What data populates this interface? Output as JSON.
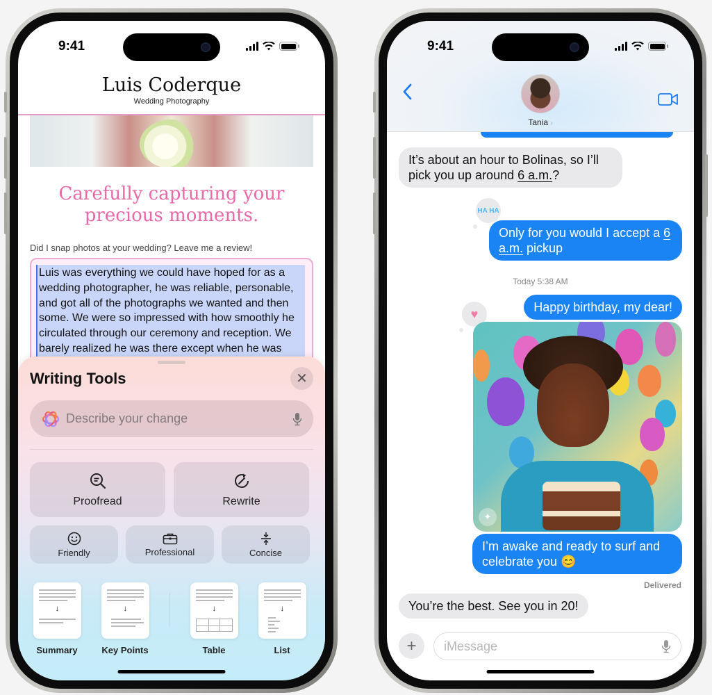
{
  "left_phone": {
    "status": {
      "time": "9:41"
    },
    "site": {
      "title": "Luis Coderque",
      "subtitle": "Wedding Photography",
      "tagline_line1": "Carefully capturing your",
      "tagline_line2": "precious moments.",
      "review_prompt": "Did I snap photos at your wedding? Leave me a review!",
      "review_text": "Luis was everything we could have hoped for as a wedding photographer, he was reliable, personable, and got all of the photographs we wanted and then some. We were so impressed with how smoothly he circulated through our ceremony and reception. We barely realized he was there except when he was very"
    },
    "writing_tools": {
      "title": "Writing Tools",
      "close_icon": "close-icon",
      "input_placeholder": "Describe your change",
      "primary_tools": [
        {
          "label": "Proofread",
          "icon": "proofread-magnifier-icon"
        },
        {
          "label": "Rewrite",
          "icon": "rewrite-icon"
        }
      ],
      "tone_tools": [
        {
          "label": "Friendly",
          "icon": "smiley-icon"
        },
        {
          "label": "Professional",
          "icon": "briefcase-icon"
        },
        {
          "label": "Concise",
          "icon": "compress-icon"
        }
      ],
      "format_tools": [
        {
          "label": "Summary"
        },
        {
          "label": "Key Points"
        },
        {
          "label": "Table"
        },
        {
          "label": "List"
        }
      ]
    }
  },
  "right_phone": {
    "status": {
      "time": "9:41"
    },
    "contact": {
      "name": "Tania",
      "chevron": "›"
    },
    "messages": [
      {
        "dir": "in",
        "text_pre": "It’s about an hour to Bolinas, so I’ll pick you up around ",
        "link": "6 a.m.",
        "text_post": "?"
      },
      {
        "dir": "out",
        "text_pre": "Only for you would I accept a ",
        "link": "6 a.m.",
        "text_post": " pickup",
        "reaction": "HA HA"
      },
      {
        "dir": "out",
        "text": "Happy birthday, my dear!",
        "reaction": "♥"
      },
      {
        "dir": "out",
        "type": "image",
        "alt": "Genmoji birthday portrait with balloons and cake"
      },
      {
        "dir": "out",
        "text": "I’m awake and ready to surf and celebrate you 😊"
      },
      {
        "dir": "in",
        "text": "You’re the best. See you in 20!"
      }
    ],
    "timestamp": "Today 5:38 AM",
    "delivered": "Delivered",
    "composer": {
      "placeholder": "iMessage"
    },
    "colors": {
      "bubble_out": "#1a84f4",
      "bubble_in": "#e9e9eb",
      "accent": "#1a7cf5"
    }
  }
}
